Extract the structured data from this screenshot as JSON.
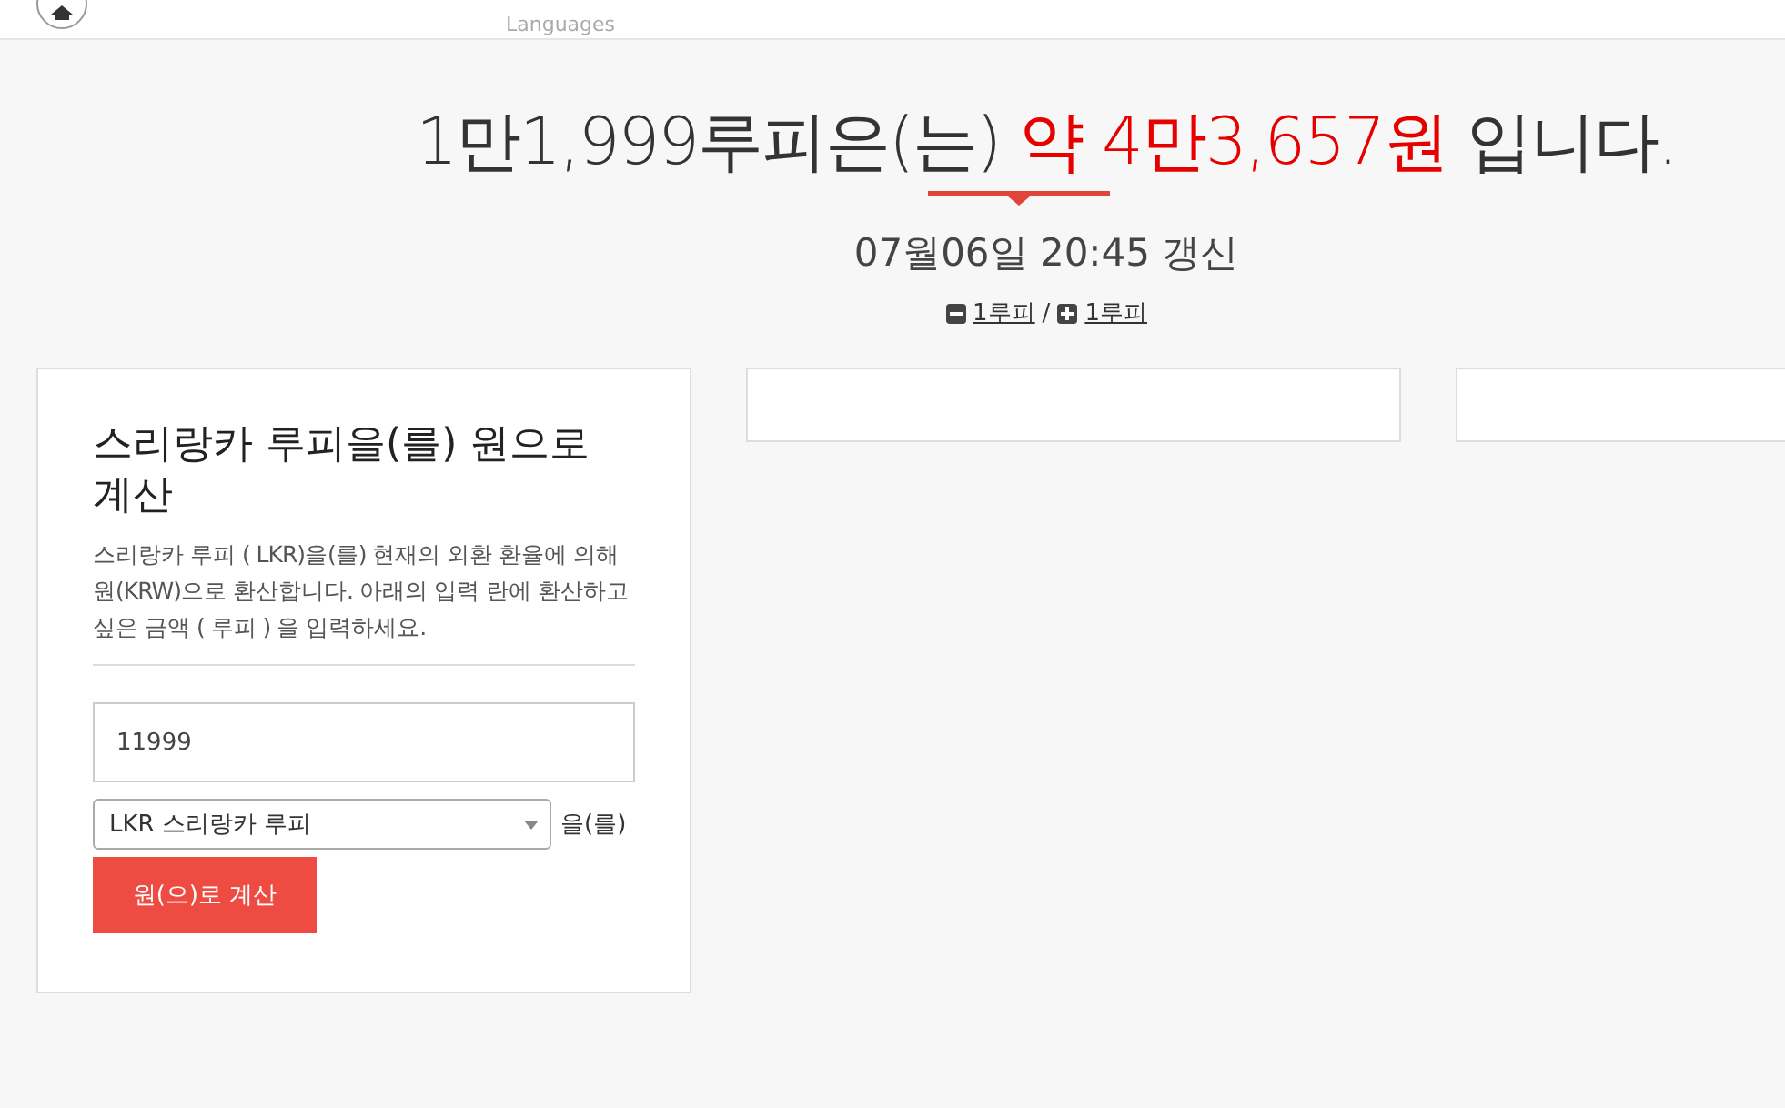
{
  "nav": {
    "items": [
      {
        "label": "Languages"
      }
    ]
  },
  "headline": [
    {
      "text": "1만1,999루피은(는) ",
      "highlight": false
    },
    {
      "text": "약 4만3,657원",
      "highlight": true
    },
    {
      "text": " 입니다.",
      "highlight": false
    }
  ],
  "updated": "07월06일 20:45 갱신",
  "steps": {
    "minus": "1루피",
    "separator": "/",
    "plus": "1루피"
  },
  "converter": {
    "title": "스리랑카 루피을(를) 원으로 계산",
    "description": "스리랑카 루피 ( LKR)을(를) 현재의 외환 환율에 의해 원(KRW)으로 환산합니다. 아래의 입력 란에 환산하고 싶은 금액 ( 루피 ) 을 입력하세요.",
    "amount": "11999",
    "currency": "LKR 스리랑카 루피",
    "suffix": "을(를)",
    "button": "원(으)로 계산"
  }
}
